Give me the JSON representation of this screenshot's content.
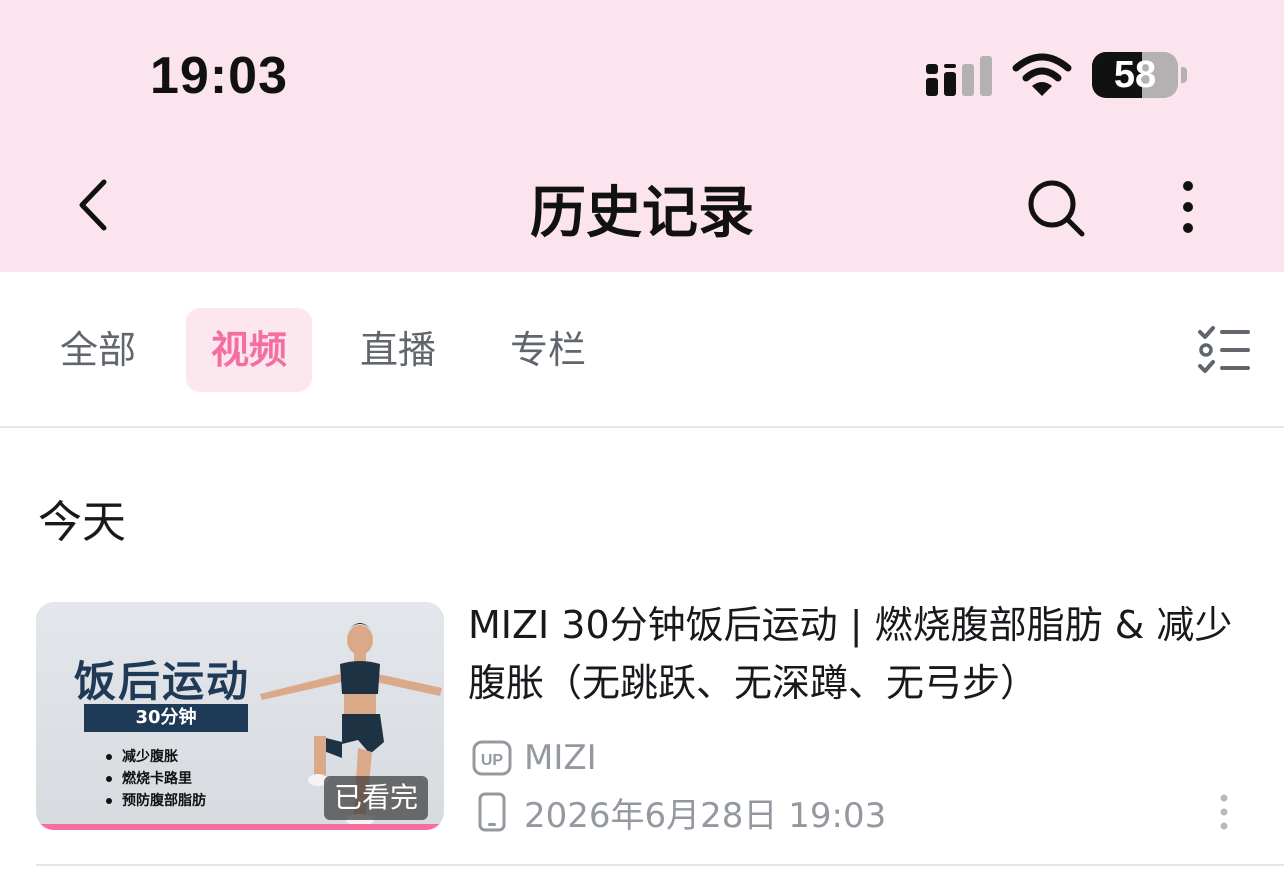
{
  "status_bar": {
    "time": "19:03",
    "battery_level": "58",
    "battery_fraction": 0.58
  },
  "nav": {
    "title": "历史记录",
    "icons": [
      "back-icon",
      "search-icon",
      "more-vertical-icon"
    ]
  },
  "tabs": [
    {
      "label": "全部",
      "active": false
    },
    {
      "label": "视频",
      "active": true
    },
    {
      "label": "直播",
      "active": false
    },
    {
      "label": "专栏",
      "active": false
    }
  ],
  "list_mode_icon": "checklist-icon",
  "sections": [
    {
      "title": "今天",
      "items": [
        {
          "thumbnail": {
            "heading": "饭后运动",
            "duration_label": "30分钟",
            "bullets": [
              "减少腹胀",
              "燃烧卡路里",
              "预防腹部脂肪"
            ],
            "badge": "已看完",
            "progress": 1.0
          },
          "title": "MIZI 30分钟饭后运动 | 燃烧腹部脂肪 & 减少腹胀（无跳跃、无深蹲、无弓步）",
          "uploader_badge": "UP",
          "uploader": "MIZI",
          "watched_at": "2026年6月28日 19:03",
          "device_icon": "phone-icon"
        }
      ]
    }
  ],
  "colors": {
    "header_bg": "#fbe4ee",
    "accent_pink": "#f46fa0",
    "active_tab_bg": "#fde7ef",
    "muted_text": "#9499a0"
  }
}
